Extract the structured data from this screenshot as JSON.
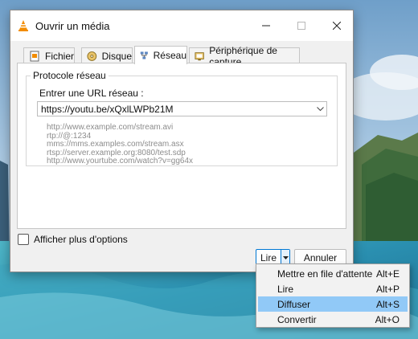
{
  "window": {
    "title": "Ouvrir un média",
    "icon": "vlc-cone-icon",
    "controls": {
      "minimize": "minimize-icon",
      "maximize": "maximize-icon",
      "close": "close-icon"
    }
  },
  "tabs": [
    {
      "label": "Fichier",
      "icon": "file-icon",
      "active": false
    },
    {
      "label": "Disque",
      "icon": "disc-icon",
      "active": false
    },
    {
      "label": "Réseau",
      "icon": "network-icon",
      "active": true
    },
    {
      "label": "Périphérique de capture",
      "icon": "capture-device-icon",
      "active": false
    }
  ],
  "network": {
    "group_title": "Protocole réseau",
    "url_label": "Entrer une URL réseau :",
    "url_value": "https://youtu.be/xQxlLWPb21M",
    "examples": [
      "http://www.example.com/stream.avi",
      "rtp://@:1234",
      "mms://mms.examples.com/stream.asx",
      "rtsp://server.example.org:8080/test.sdp",
      "http://www.yourtube.com/watch?v=gg64x"
    ]
  },
  "options": {
    "show_more_label": "Afficher plus d'options",
    "checked": false
  },
  "buttons": {
    "play": "Lire",
    "cancel": "Annuler"
  },
  "play_menu": {
    "items": [
      {
        "label": "Mettre en file d'attente",
        "shortcut": "Alt+E",
        "highlighted": false
      },
      {
        "label": "Lire",
        "shortcut": "Alt+P",
        "highlighted": false
      },
      {
        "label": "Diffuser",
        "shortcut": "Alt+S",
        "highlighted": true
      },
      {
        "label": "Convertir",
        "shortcut": "Alt+O",
        "highlighted": false
      }
    ]
  },
  "colors": {
    "accent": "#0078d4",
    "menu_highlight": "#91c9f7",
    "vlc_orange": "#f28c00"
  }
}
